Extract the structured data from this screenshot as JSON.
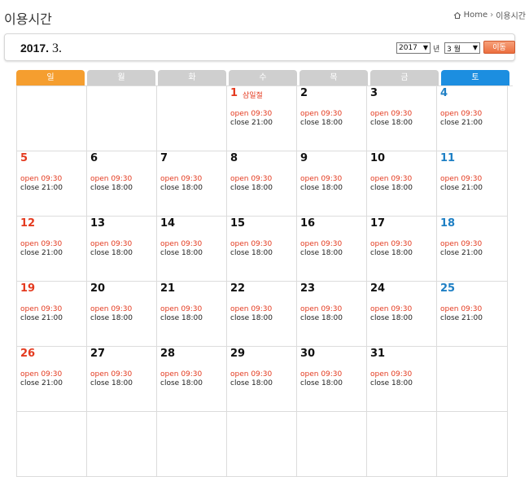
{
  "page": {
    "title": "이용시간"
  },
  "breadcrumb": {
    "home": "Home",
    "current": "이용시간"
  },
  "toolbar": {
    "year_label": "2017.",
    "month_label": "3.",
    "year_select": "2017",
    "year_unit": "년",
    "month_select": "3 월",
    "go_label": "이동"
  },
  "weekdays": [
    "일",
    "월",
    "화",
    "수",
    "목",
    "금",
    "토"
  ],
  "weeks": [
    [
      {
        "day": "",
        "open": "",
        "close": "",
        "holiday": ""
      },
      {
        "day": "",
        "open": "",
        "close": "",
        "holiday": ""
      },
      {
        "day": "",
        "open": "",
        "close": "",
        "holiday": ""
      },
      {
        "day": "1",
        "open": "open 09:30",
        "close": "close 21:00",
        "holiday": "삼일절",
        "red": true
      },
      {
        "day": "2",
        "open": "open 09:30",
        "close": "close 18:00",
        "holiday": ""
      },
      {
        "day": "3",
        "open": "open 09:30",
        "close": "close 18:00",
        "holiday": ""
      },
      {
        "day": "4",
        "open": "open 09:30",
        "close": "close 21:00",
        "holiday": ""
      }
    ],
    [
      {
        "day": "5",
        "open": "open 09:30",
        "close": "close 21:00",
        "holiday": ""
      },
      {
        "day": "6",
        "open": "open 09:30",
        "close": "close 18:00",
        "holiday": ""
      },
      {
        "day": "7",
        "open": "open 09:30",
        "close": "close 18:00",
        "holiday": ""
      },
      {
        "day": "8",
        "open": "open 09:30",
        "close": "close 18:00",
        "holiday": ""
      },
      {
        "day": "9",
        "open": "open 09:30",
        "close": "close 18:00",
        "holiday": ""
      },
      {
        "day": "10",
        "open": "open 09:30",
        "close": "close 18:00",
        "holiday": ""
      },
      {
        "day": "11",
        "open": "open 09:30",
        "close": "close 21:00",
        "holiday": ""
      }
    ],
    [
      {
        "day": "12",
        "open": "open 09:30",
        "close": "close 21:00",
        "holiday": ""
      },
      {
        "day": "13",
        "open": "open 09:30",
        "close": "close 18:00",
        "holiday": ""
      },
      {
        "day": "14",
        "open": "open 09:30",
        "close": "close 18:00",
        "holiday": ""
      },
      {
        "day": "15",
        "open": "open 09:30",
        "close": "close 18:00",
        "holiday": ""
      },
      {
        "day": "16",
        "open": "open 09:30",
        "close": "close 18:00",
        "holiday": ""
      },
      {
        "day": "17",
        "open": "open 09:30",
        "close": "close 18:00",
        "holiday": ""
      },
      {
        "day": "18",
        "open": "open 09:30",
        "close": "close 21:00",
        "holiday": ""
      }
    ],
    [
      {
        "day": "19",
        "open": "open 09:30",
        "close": "close 21:00",
        "holiday": ""
      },
      {
        "day": "20",
        "open": "open 09:30",
        "close": "close 18:00",
        "holiday": ""
      },
      {
        "day": "21",
        "open": "open 09:30",
        "close": "close 18:00",
        "holiday": ""
      },
      {
        "day": "22",
        "open": "open 09:30",
        "close": "close 18:00",
        "holiday": ""
      },
      {
        "day": "23",
        "open": "open 09:30",
        "close": "close 18:00",
        "holiday": ""
      },
      {
        "day": "24",
        "open": "open 09:30",
        "close": "close 18:00",
        "holiday": ""
      },
      {
        "day": "25",
        "open": "open 09:30",
        "close": "close 21:00",
        "holiday": ""
      }
    ],
    [
      {
        "day": "26",
        "open": "open 09:30",
        "close": "close 21:00",
        "holiday": ""
      },
      {
        "day": "27",
        "open": "open 09:30",
        "close": "close 18:00",
        "holiday": ""
      },
      {
        "day": "28",
        "open": "open 09:30",
        "close": "close 18:00",
        "holiday": ""
      },
      {
        "day": "29",
        "open": "open 09:30",
        "close": "close 18:00",
        "holiday": ""
      },
      {
        "day": "30",
        "open": "open 09:30",
        "close": "close 18:00",
        "holiday": ""
      },
      {
        "day": "31",
        "open": "open 09:30",
        "close": "close 18:00",
        "holiday": ""
      },
      {
        "day": "",
        "open": "",
        "close": "",
        "holiday": ""
      }
    ],
    [
      {
        "day": "",
        "open": "",
        "close": "",
        "holiday": ""
      },
      {
        "day": "",
        "open": "",
        "close": "",
        "holiday": ""
      },
      {
        "day": "",
        "open": "",
        "close": "",
        "holiday": ""
      },
      {
        "day": "",
        "open": "",
        "close": "",
        "holiday": ""
      },
      {
        "day": "",
        "open": "",
        "close": "",
        "holiday": ""
      },
      {
        "day": "",
        "open": "",
        "close": "",
        "holiday": ""
      },
      {
        "day": "",
        "open": "",
        "close": "",
        "holiday": ""
      }
    ]
  ],
  "colors": {
    "sunday": "#e43a1f",
    "saturday": "#1e7fc4",
    "accent": "#f59e2f"
  }
}
